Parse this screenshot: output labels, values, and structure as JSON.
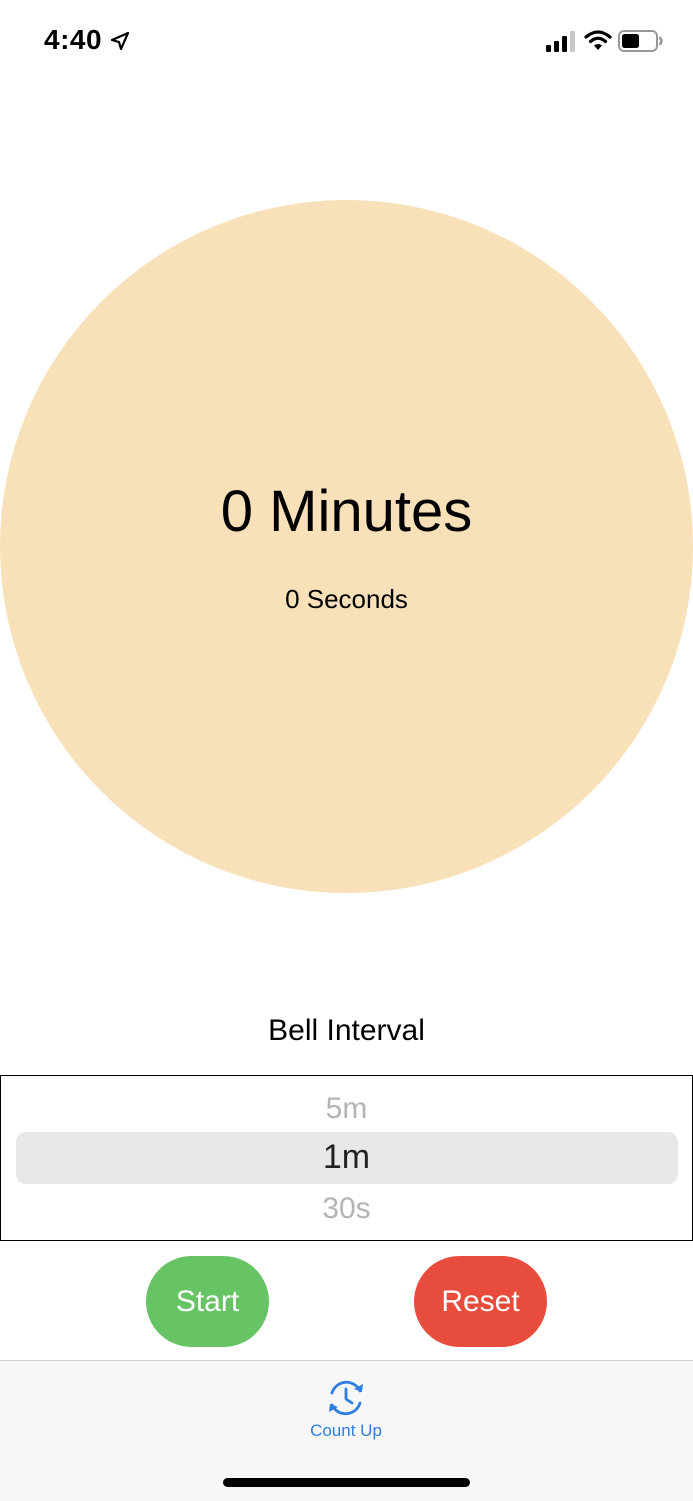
{
  "status_bar": {
    "time": "4:40",
    "icons": [
      "location-arrow-icon",
      "cellular-signal-icon",
      "wifi-icon",
      "battery-icon"
    ]
  },
  "timer": {
    "minutes_text": "0 Minutes",
    "seconds_text": "0 Seconds",
    "circle_color": "#f8e0b8"
  },
  "bell_interval": {
    "label": "Bell Interval",
    "options": [
      "5m",
      "1m",
      "30s"
    ],
    "selected": "1m"
  },
  "buttons": {
    "start_label": "Start",
    "start_color": "#66c465",
    "reset_label": "Reset",
    "reset_color": "#e74c3c"
  },
  "tab_bar": {
    "items": [
      {
        "label": "Count Up",
        "icon": "clock-refresh-icon",
        "color": "#2f7de1"
      }
    ]
  }
}
